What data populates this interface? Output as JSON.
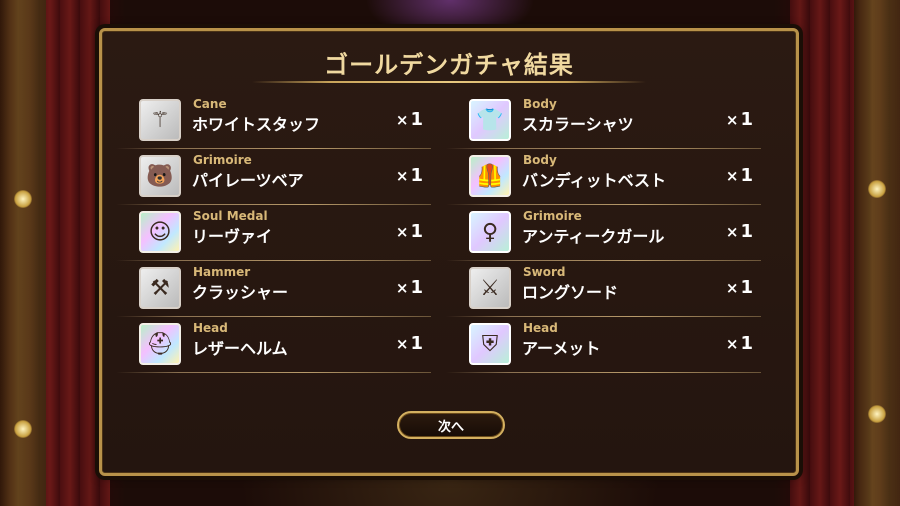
{
  "dialog": {
    "title": "ゴールデンガチャ結果",
    "next_label": "次へ"
  },
  "items": [
    {
      "category": "Cane",
      "name": "ホワイトスタッフ",
      "qty_prefix": "×",
      "qty": "1",
      "icon": "staff-icon",
      "glyph": "⚚"
    },
    {
      "category": "Body",
      "name": "スカラーシャツ",
      "qty_prefix": "×",
      "qty": "1",
      "icon": "shirt-icon",
      "glyph": "👕"
    },
    {
      "category": "Grimoire",
      "name": "パイレーツベア",
      "qty_prefix": "×",
      "qty": "1",
      "icon": "pirate-bear-icon",
      "glyph": "🐻"
    },
    {
      "category": "Body",
      "name": "バンディットベスト",
      "qty_prefix": "×",
      "qty": "1",
      "icon": "vest-icon",
      "glyph": "🦺"
    },
    {
      "category": "Soul Medal",
      "name": "リーヴァイ",
      "qty_prefix": "×",
      "qty": "1",
      "icon": "character-portrait-icon",
      "glyph": "☺"
    },
    {
      "category": "Grimoire",
      "name": "アンティークガール",
      "qty_prefix": "×",
      "qty": "1",
      "icon": "antique-girl-icon",
      "glyph": "♀"
    },
    {
      "category": "Hammer",
      "name": "クラッシャー",
      "qty_prefix": "×",
      "qty": "1",
      "icon": "hammer-icon",
      "glyph": "⚒"
    },
    {
      "category": "Sword",
      "name": "ロングソード",
      "qty_prefix": "×",
      "qty": "1",
      "icon": "sword-icon",
      "glyph": "⚔"
    },
    {
      "category": "Head",
      "name": "レザーヘルム",
      "qty_prefix": "×",
      "qty": "1",
      "icon": "helmet-icon",
      "glyph": "⛑"
    },
    {
      "category": "Head",
      "name": "アーメット",
      "qty_prefix": "×",
      "qty": "1",
      "icon": "armet-icon",
      "glyph": "⛨"
    }
  ],
  "colors": {
    "accent_gold": "#b8924a",
    "category_text": "#d8b878",
    "title_text": "#f0d9a0"
  }
}
